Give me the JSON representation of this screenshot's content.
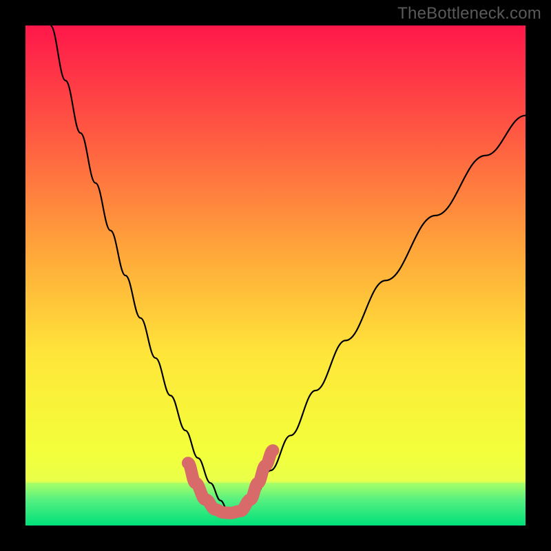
{
  "watermark": "TheBottleneck.com",
  "chart_data": {
    "type": "line",
    "title": "",
    "xlabel": "",
    "ylabel": "",
    "xlim": [
      0,
      100
    ],
    "ylim": [
      0,
      100
    ],
    "grid": false,
    "legend": false,
    "background_gradient": {
      "top": "#ff174a",
      "upper_mid": "#ff7a3a",
      "mid": "#ffd23a",
      "lower_mid": "#f5ff3a",
      "green_band_top": "#8cff66",
      "bottom": "#00e57a"
    },
    "series": [
      {
        "name": "bottleneck-curve",
        "color": "#000000",
        "stroke_width": 2.2,
        "x": [
          5,
          8,
          11,
          14,
          17,
          20,
          23,
          26,
          29,
          32,
          34.5,
          37,
          39,
          40.5,
          41.2,
          43,
          46,
          49,
          53,
          58,
          64,
          72,
          82,
          92,
          100
        ],
        "y": [
          100,
          89,
          78.5,
          68.5,
          59,
          50,
          41.5,
          33.5,
          26,
          19,
          13.5,
          8.5,
          5,
          3,
          2.5,
          3,
          6,
          11,
          18,
          27,
          37,
          49,
          62,
          74,
          82
        ],
        "note": "x and y are percentages of plot width/height; y=0 at bottom, y=100 at top"
      },
      {
        "name": "highlight-band",
        "color": "#d86a6a",
        "stroke_width": 18,
        "stroke_linecap": "round",
        "x": [
          32.5,
          34,
          36,
          38,
          39.5,
          41,
          43,
          45,
          46.5,
          48,
          49.5
        ],
        "y": [
          12.5,
          8.5,
          5.2,
          3.2,
          2.6,
          2.5,
          2.9,
          5.2,
          8.5,
          12,
          15
        ],
        "note": "thick salmon overlay near curve minimum"
      }
    ],
    "annotations": []
  }
}
